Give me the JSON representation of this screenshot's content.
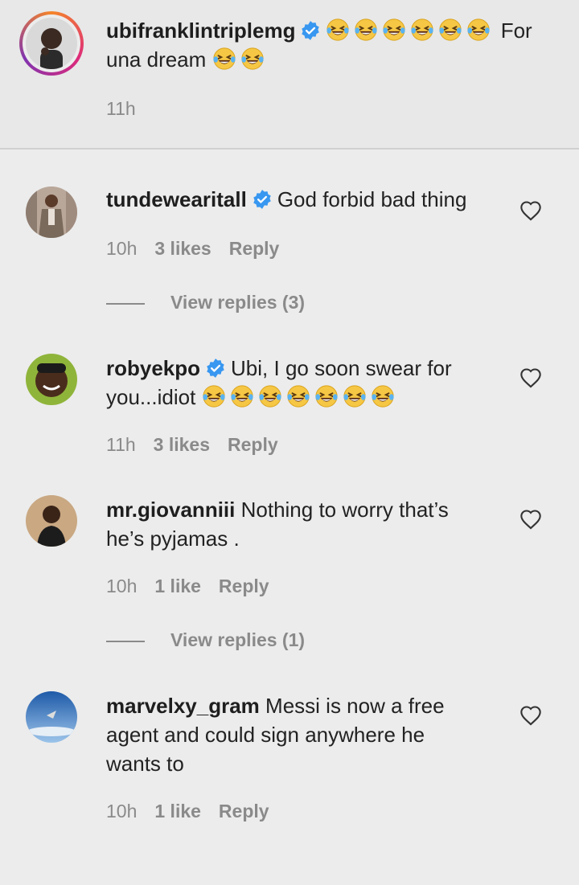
{
  "caption": {
    "username": "ubifranklintriplemg",
    "verified": true,
    "emoji_count_1": 6,
    "text_part1": "For",
    "text_part2": "una dream",
    "emoji_count_2": 2,
    "time": "11h"
  },
  "comments": [
    {
      "username": "tundewearitall",
      "verified": true,
      "text": "God forbid bad thing",
      "time": "10h",
      "likes": "3 likes",
      "reply": "Reply",
      "view_replies": "View replies (3)"
    },
    {
      "username": "robyekpo",
      "verified": true,
      "text_line1": "Ubi, I go soon swear for",
      "text_line2": "you...idiot",
      "emoji_count": 7,
      "time": "11h",
      "likes": "3 likes",
      "reply": "Reply"
    },
    {
      "username": "mr.giovanniii",
      "verified": false,
      "text_line1": "Nothing to worry that’s",
      "text_line2": "he’s pyjamas .",
      "time": "10h",
      "likes": "1 like",
      "reply": "Reply",
      "view_replies": "View replies (1)"
    },
    {
      "username": "marvelxy_gram",
      "verified": false,
      "text_line1": "Messi is now a free",
      "text_line2": "agent and could sign anywhere he",
      "text_line3": "wants to",
      "time": "10h",
      "likes": "1 like",
      "reply": "Reply"
    }
  ],
  "colors": {
    "verified_blue": "#3897f0",
    "meta_gray": "#8a8a8a",
    "background": "#ececec"
  }
}
